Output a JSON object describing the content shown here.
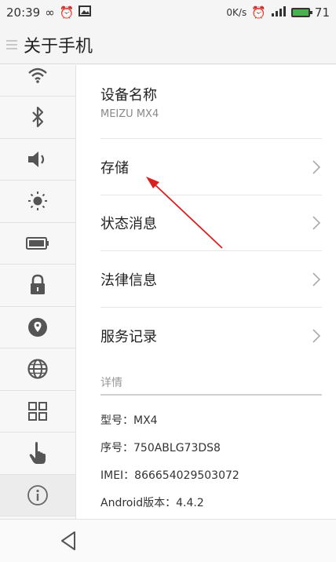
{
  "status_bar": {
    "time": "20:39",
    "network_speed": "0K/s",
    "battery_level": "71",
    "battery_color": "#4caf50",
    "icons": [
      "infinity-icon",
      "alarm-icon",
      "image-icon",
      "alarm-icon",
      "signal-icon",
      "battery-icon"
    ]
  },
  "header": {
    "title": "关于手机"
  },
  "sidebar": {
    "items": [
      {
        "icon": "wifi-icon"
      },
      {
        "icon": "bluetooth-icon"
      },
      {
        "icon": "speaker-icon"
      },
      {
        "icon": "brightness-icon"
      },
      {
        "icon": "battery-icon"
      },
      {
        "icon": "lock-icon"
      },
      {
        "icon": "location-icon"
      },
      {
        "icon": "globe-icon"
      },
      {
        "icon": "grid-icon"
      },
      {
        "icon": "hand-pointer-icon"
      },
      {
        "icon": "info-icon",
        "active": true
      }
    ]
  },
  "main": {
    "device_name": {
      "title": "设备名称",
      "value": "MEIZU MX4"
    },
    "menu": [
      {
        "label": "存储"
      },
      {
        "label": "状态消息"
      },
      {
        "label": "法律信息"
      },
      {
        "label": "服务记录"
      }
    ],
    "details_label": "详情",
    "details": [
      "型号：MX4",
      "序号：750ABLG73DS8",
      "IMEI：866654029503072",
      "Android版本：4.4.2"
    ]
  },
  "colors": {
    "annotation_arrow": "#d9201f",
    "accent": "#4caf50"
  }
}
